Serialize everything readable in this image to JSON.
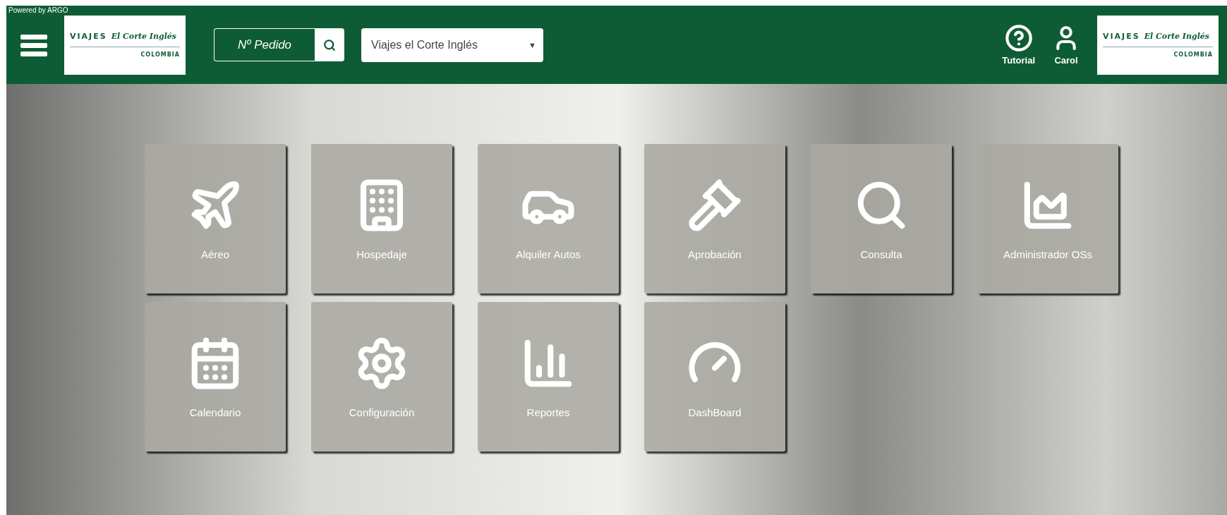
{
  "header": {
    "powered_by": "Powered by ARGO",
    "logo": {
      "brand": "VIAJES",
      "script": "El Corte Inglés",
      "country": "COLOMBIA"
    },
    "order_search": {
      "placeholder": "Nº Pedido"
    },
    "agency_select": {
      "value": "Viajes el Corte Inglés",
      "caret": "▼"
    },
    "actions": [
      {
        "label": "Tutorial"
      },
      {
        "label": "Carol"
      }
    ],
    "right_logo": {
      "brand": "VIAJES",
      "script": "El Corte Inglés",
      "country": "COLOMBIA"
    }
  },
  "tiles": [
    [
      {
        "label": "Aéreo"
      },
      {
        "label": "Hospedaje"
      },
      {
        "label": "Alquiler Autos"
      },
      {
        "label": "Aprobación"
      },
      {
        "label": "Consulta"
      },
      {
        "label": "Administrador OSs"
      }
    ],
    [
      {
        "label": "Calendario"
      },
      {
        "label": "Configuración"
      },
      {
        "label": "Reportes"
      },
      {
        "label": "DashBoard"
      }
    ]
  ]
}
